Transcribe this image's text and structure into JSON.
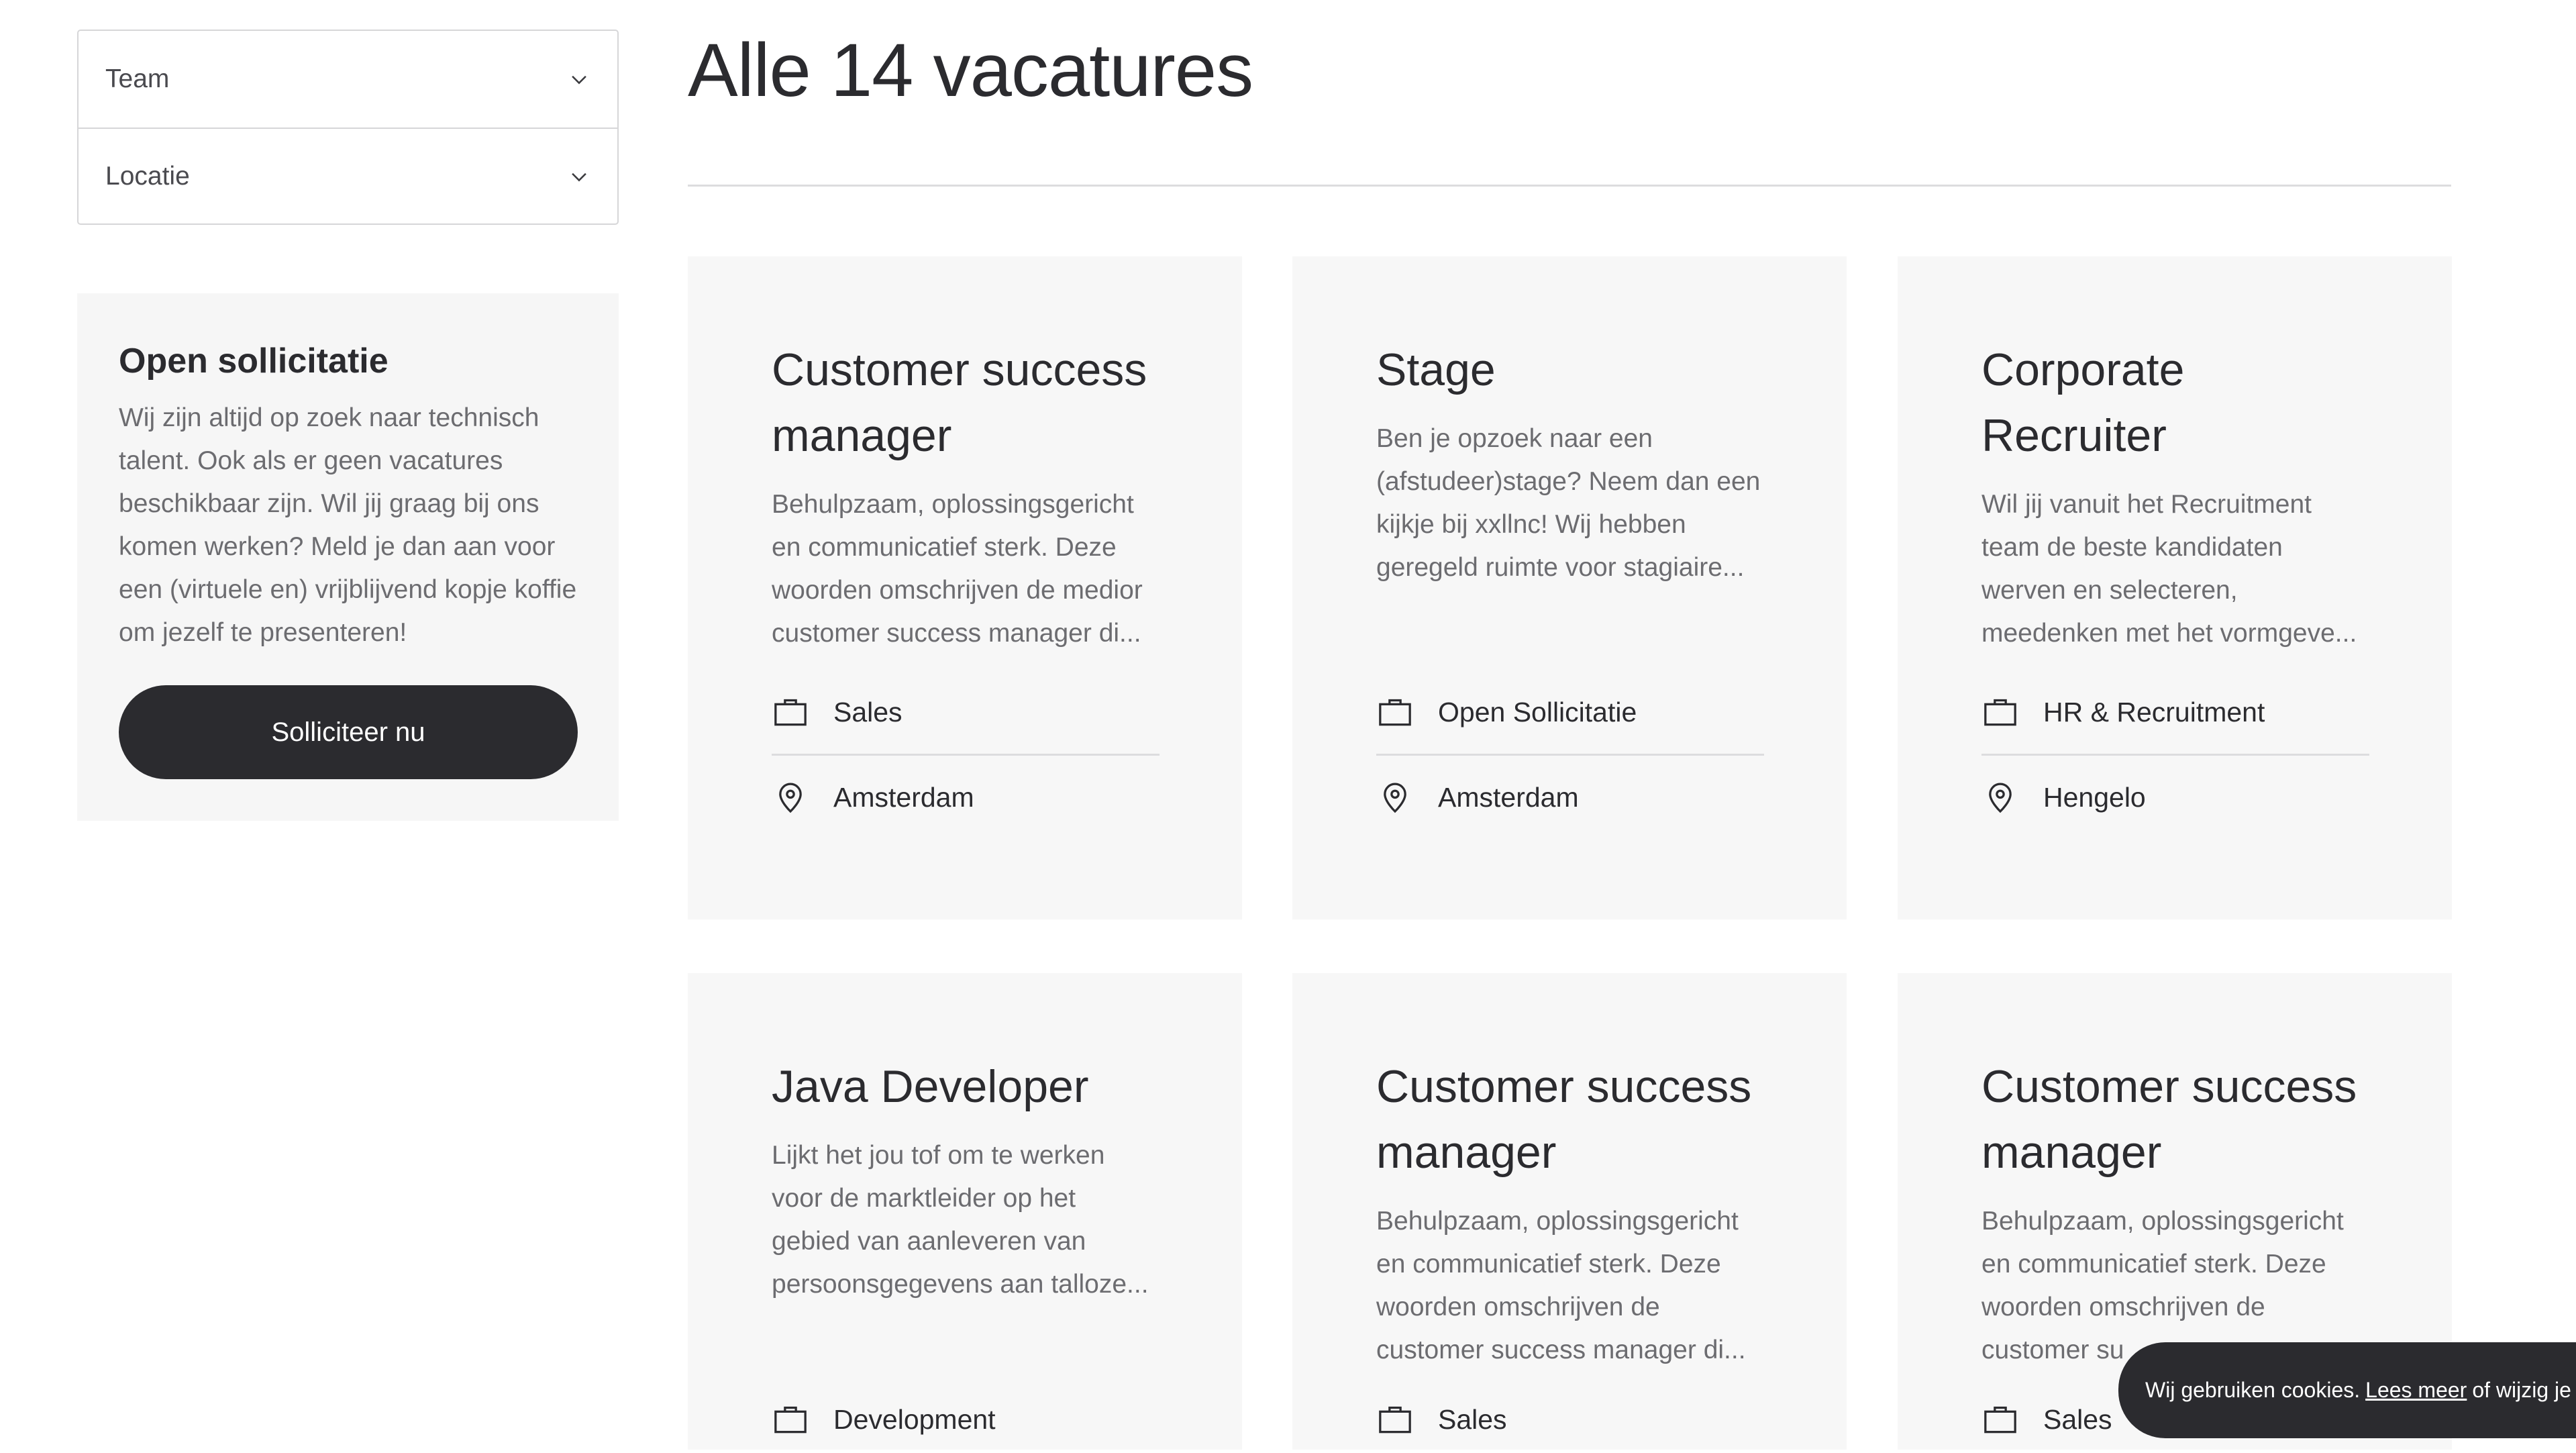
{
  "filters": [
    {
      "label": "Team"
    },
    {
      "label": "Locatie"
    }
  ],
  "open_application": {
    "title": "Open sollicitatie",
    "text": "Wij zijn altijd op zoek naar technisch talent. Ook als er geen vacatures beschikbaar zijn. Wil jij graag bij ons komen werken? Meld je dan aan voor een (virtuele en) vrijblijvend kopje koffie om jezelf te presenteren!",
    "button": "Solliciteer nu"
  },
  "page_title": "Alle 14 vacatures",
  "jobs": [
    {
      "title": "Customer success manager",
      "description": "Behulpzaam, oplossingsgericht en communicatief sterk. Deze woorden omschrijven de medior customer success manager di...",
      "team": "Sales",
      "location": "Amsterdam"
    },
    {
      "title": "Stage",
      "description": "Ben je opzoek naar een (afstudeer)stage? Neem dan een kijkje bij xxllnc! Wij hebben geregeld ruimte voor stagiaire...",
      "team": "Open Sollicitatie",
      "location": "Amsterdam"
    },
    {
      "title": "Corporate Recruiter",
      "description": "Wil jij vanuit het Recruitment team de beste kandidaten werven en selecteren, meedenken met het vormgeve...",
      "team": "HR & Recruitment",
      "location": "Hengelo"
    },
    {
      "title": "Java Developer",
      "description": "Lijkt het jou tof om te werken voor de marktleider op het gebied van aanleveren van persoonsgegevens aan talloze...",
      "team": "Development",
      "location": ""
    },
    {
      "title": "Customer success manager",
      "description": "Behulpzaam, oplossingsgericht en communicatief sterk. Deze woorden omschrijven de customer success manager di...",
      "team": "Sales",
      "location": ""
    },
    {
      "title": "Customer success manager",
      "description": "Behulpzaam, oplossingsgericht en communicatief sterk. Deze woorden omschrijven de customer su",
      "team": "Sales",
      "location": ""
    }
  ],
  "cookie": {
    "text_before": "Wij gebruiken cookies.",
    "link": "Lees meer",
    "text_after": "of wijzig je v"
  },
  "icons": {
    "team": "briefcase-icon",
    "location": "map-pin-icon",
    "dropdown": "chevron-down-icon"
  }
}
